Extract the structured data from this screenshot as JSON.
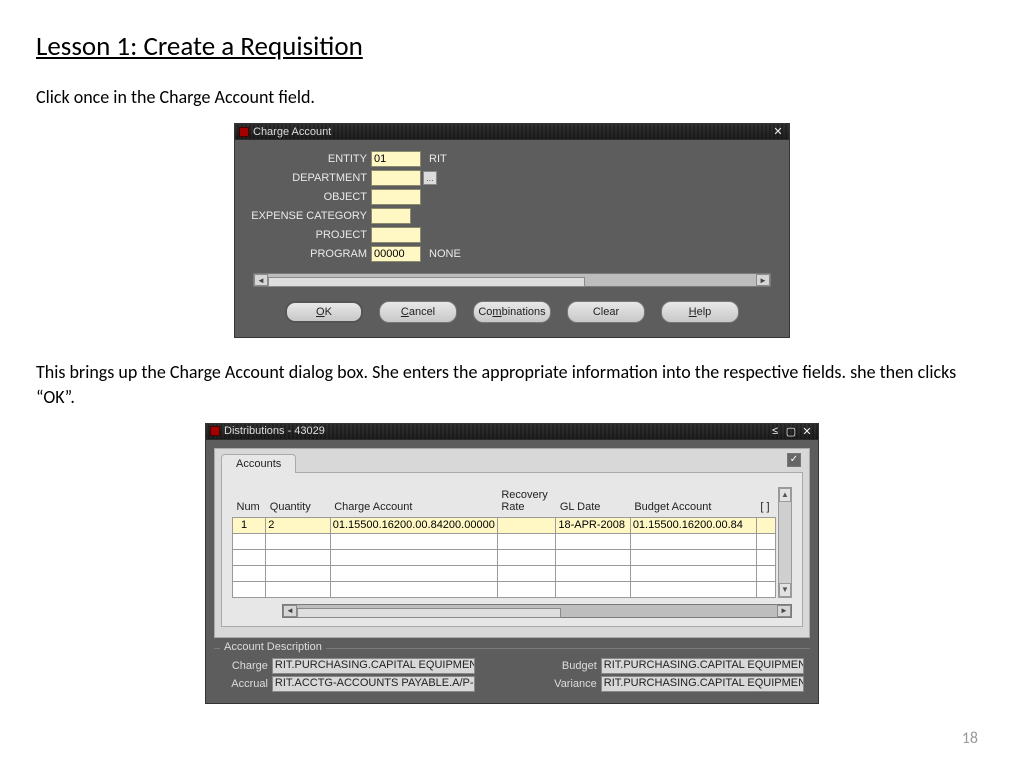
{
  "page": {
    "title": "Lesson 1:  Create a Requisition",
    "para1": "Click once in the Charge Account field.",
    "para2": "This brings up the Charge Account dialog box.  She enters the appropriate information into the respective fields.  she then clicks “OK”.",
    "page_number": "18"
  },
  "charge_account": {
    "title": "Charge Account",
    "fields": {
      "entity_label": "ENTITY",
      "entity_value": "01",
      "entity_desc": "RIT",
      "department_label": "DEPARTMENT",
      "department_value": "",
      "object_label": "OBJECT",
      "object_value": "",
      "expense_cat_label": "EXPENSE CATEGORY",
      "expense_cat_value": "",
      "project_label": "PROJECT",
      "project_value": "",
      "program_label": "PROGRAM",
      "program_value": "00000",
      "program_desc": "NONE"
    },
    "buttons": {
      "ok": "OK",
      "cancel": "Cancel",
      "combinations": "Combinations",
      "clear": "Clear",
      "help": "Help"
    }
  },
  "distributions": {
    "title": "Distributions - 43029",
    "tab": "Accounts",
    "columns": {
      "num": "Num",
      "quantity": "Quantity",
      "charge_account": "Charge Account",
      "recovery_rate_l1": "Recovery",
      "recovery_rate_l2": "Rate",
      "gl_date": "GL Date",
      "budget_account": "Budget Account",
      "end": "[ ]"
    },
    "row": {
      "num": "1",
      "quantity": "2",
      "charge_account": "01.15500.16200.00.84200.00000",
      "recovery_rate": "",
      "gl_date": "18-APR-2008",
      "budget_account": "01.15500.16200.00.84"
    },
    "footer": {
      "title": "Account Description",
      "charge_label": "Charge",
      "charge_value": "RIT.PURCHASING.CAPITAL EQUIPMEN",
      "accrual_label": "Accrual",
      "accrual_value": "RIT.ACCTG-ACCOUNTS PAYABLE.A/P-",
      "budget_label": "Budget",
      "budget_value": "RIT.PURCHASING.CAPITAL EQUIPMEN",
      "variance_label": "Variance",
      "variance_value": "RIT.PURCHASING.CAPITAL EQUIPMEN"
    }
  }
}
